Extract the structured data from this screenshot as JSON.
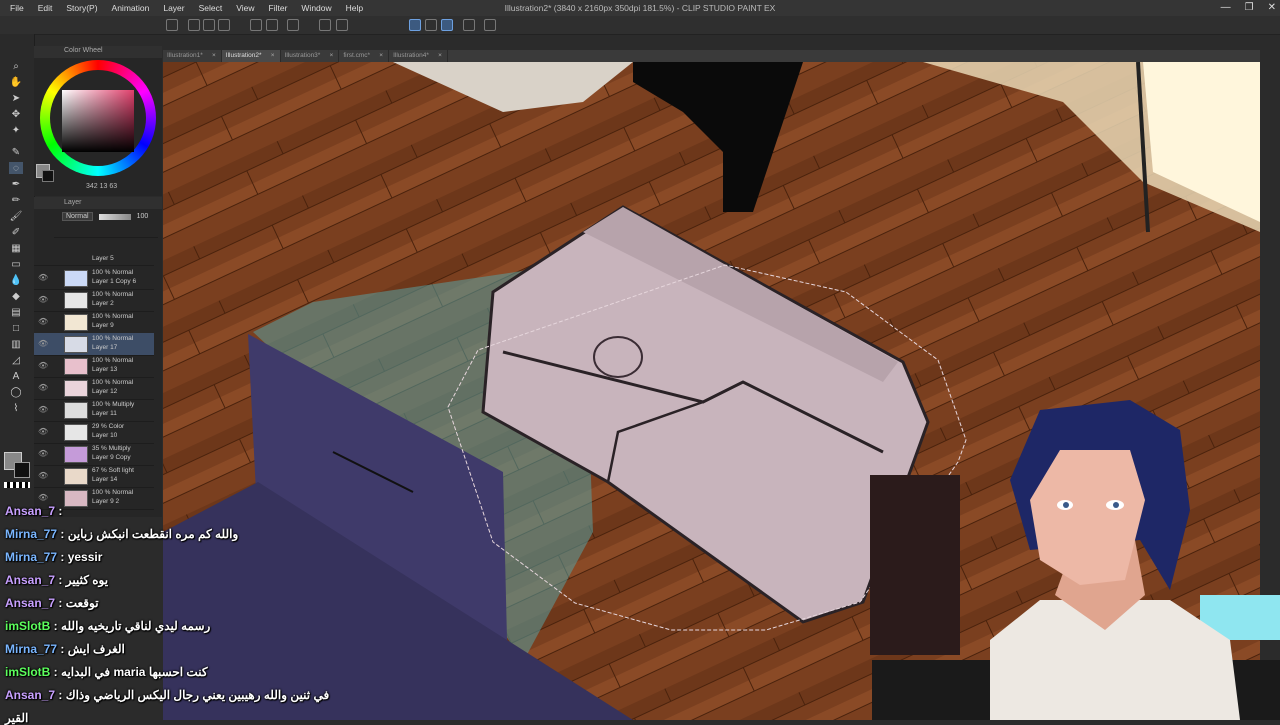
{
  "app": {
    "title": "Illustration2* (3840 x 2160px 350dpi 181.5%) - CLIP STUDIO PAINT EX",
    "menu": [
      "File",
      "Edit",
      "Story(P)",
      "Animation",
      "Layer",
      "Select",
      "View",
      "Filter",
      "Window",
      "Help"
    ],
    "window_controls": [
      "—",
      "❐",
      "✕"
    ]
  },
  "tabs": [
    {
      "label": "Illustration1*",
      "active": false
    },
    {
      "label": "Illustration2*",
      "active": true
    },
    {
      "label": "Illustration3*",
      "active": false
    },
    {
      "label": "first.cmc*",
      "active": false
    },
    {
      "label": "Illustration4*",
      "active": false
    }
  ],
  "color_wheel": {
    "title": "Color Wheel",
    "readout": "342 13 63",
    "main_color": "#1a1a1a",
    "sub_color": "#ffffff"
  },
  "layer_panel": {
    "title": "Layer",
    "blend_mode": "Normal",
    "opacity": "100",
    "layers": [
      {
        "mode": "100 % Normal",
        "name": "Layer 1 Copy 6",
        "selected": false
      },
      {
        "mode": "100 % Normal",
        "name": "Layer 2",
        "selected": false
      },
      {
        "mode": "100 % Normal",
        "name": "Layer 9",
        "selected": false
      },
      {
        "mode": "100 % Normal",
        "name": "Layer 17",
        "selected": true
      },
      {
        "mode": "100 % Normal",
        "name": "Layer 13",
        "selected": false
      },
      {
        "mode": "100 % Normal",
        "name": "Layer 12",
        "selected": false
      },
      {
        "mode": "100 % Multiply",
        "name": "Layer 11",
        "selected": false
      },
      {
        "mode": "29 % Color",
        "name": "Layer 10",
        "selected": false
      },
      {
        "mode": "35 % Multiply",
        "name": "Layer 9 Copy",
        "selected": false
      },
      {
        "mode": "67 % Soft light",
        "name": "Layer 14",
        "selected": false
      },
      {
        "mode": "100 % Normal",
        "name": "Layer 9 2",
        "selected": false
      }
    ],
    "top_layer_name": "Layer 5"
  },
  "chat": [
    {
      "user": "Ansan_7",
      "message": "",
      "color": "#c8a0ff"
    },
    {
      "user": "Mirna_77",
      "message": "والله كم مره انقطعت انبكش زباين",
      "color": "#7ab6ff"
    },
    {
      "user": "Mirna_77",
      "message": "yessir",
      "color": "#7ab6ff"
    },
    {
      "user": "Ansan_7",
      "message": "يوه كثيير",
      "color": "#c8a0ff"
    },
    {
      "user": "Ansan_7",
      "message": "توقعت",
      "color": "#c8a0ff"
    },
    {
      "user": "imSlotB",
      "message": "رسمه ليدي لناقي تاريخيه والله",
      "color": "#5dff5d"
    },
    {
      "user": "Mirna_77",
      "message": "الغرف ايش",
      "color": "#7ab6ff"
    },
    {
      "user": "imSlotB",
      "message": "في البدايه maria كنت احسبها",
      "color": "#5dff5d"
    },
    {
      "user": "Ansan_7",
      "message": "في ثنين والله رهيبين يعني رجال اليكس الرياضي وذاك",
      "color": "#c8a0ff"
    },
    {
      "user": "",
      "message": "القير",
      "color": "#ffffff"
    }
  ],
  "colors": {
    "floor": "#7a3f1f",
    "couch": "#c8b4bc",
    "tv": "#3f3a6a",
    "selection": "#6da0e0"
  }
}
